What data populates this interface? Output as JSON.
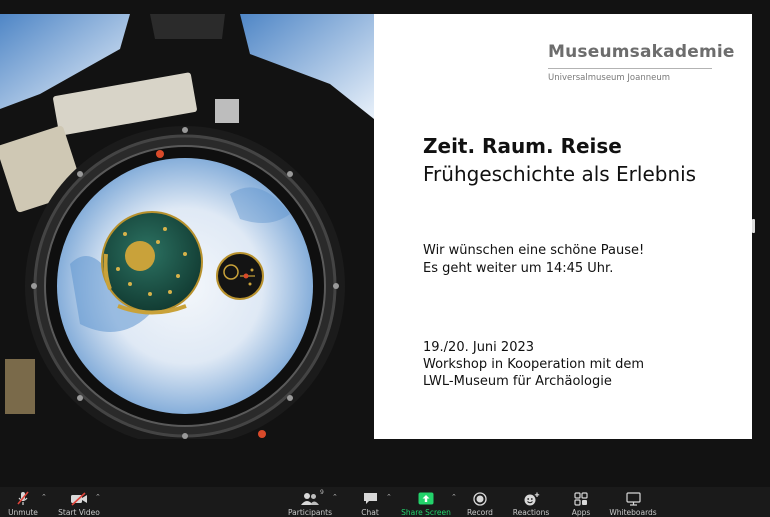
{
  "slide": {
    "brand_title": "Museumsakademie",
    "brand_subtitle": "Universalmuseum Joanneum",
    "title": "Zeit. Raum. Reise",
    "subtitle": "Frühgeschichte als Erlebnis",
    "pause_line1": "Wir wünschen eine schöne Pause!",
    "pause_line2": "Es geht weiter um 14:45 Uhr.",
    "date": "19./20. Juni 2023",
    "workshop_line1": "Workshop in Kooperation mit dem",
    "workshop_line2": "LWL-Museum für Archäologie"
  },
  "toolbar": {
    "unmute": "Unmute",
    "start_video": "Start Video",
    "participants": "Participants",
    "participants_count": "9",
    "chat": "Chat",
    "share_screen": "Share Screen",
    "record": "Record",
    "reactions": "Reactions",
    "apps": "Apps",
    "whiteboards": "Whiteboards"
  },
  "colors": {
    "background": "#141414",
    "toolbar": "#1a1a1a",
    "share_green": "#23d26b",
    "text": "#111111",
    "brand_gray": "#6d6d6d",
    "disc_green": "#1f5a4a",
    "gold": "#c9a23a"
  },
  "icons": {
    "unmute": "muted-microphone-icon",
    "start_video": "video-off-icon",
    "participants": "people-icon",
    "chat": "chat-bubble-icon",
    "share_screen": "share-arrow-icon",
    "record": "record-icon",
    "reactions": "smile-plus-icon",
    "apps": "apps-icon",
    "whiteboards": "whiteboard-icon"
  }
}
